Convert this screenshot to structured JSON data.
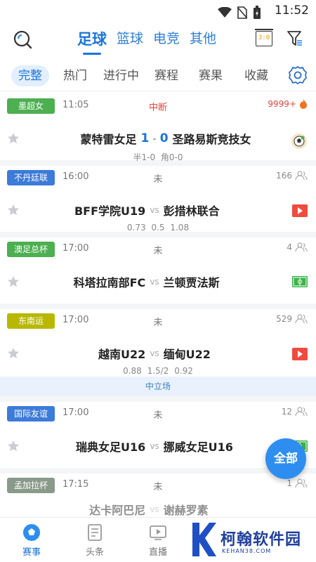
{
  "status_bar": {
    "time": "11:52"
  },
  "header": {
    "sport_tabs": [
      "足球",
      "篮球",
      "电竞",
      "其他"
    ],
    "active_sport": 0,
    "score_icon_text": "3:0"
  },
  "filter_tabs": [
    "完整",
    "热门",
    "进行中",
    "赛程",
    "赛果",
    "收藏"
  ],
  "matches": [
    {
      "league": "墨超女",
      "league_color": "#4caf50",
      "time": "11:05",
      "status": "中断",
      "count": "9999+",
      "home": "蒙特雷女足",
      "away": "圣路易斯竞技女",
      "score_home": "1",
      "score_away": "0",
      "score_sep": "-",
      "odds": "半1-0 角0-0",
      "icon": "live-ball-icon"
    },
    {
      "league": "不丹廷联",
      "league_color": "#3d7bd9",
      "time": "16:00",
      "status": "未",
      "count": "166",
      "home": "BFF学院U19",
      "away": "彭措林联合",
      "vs": "vs",
      "odds": "0.73 0.5 1.08",
      "icon": "video-icon"
    },
    {
      "league": "澳足总杯",
      "league_color": "#4caf50",
      "time": "17:00",
      "status": "未",
      "count": "4",
      "home": "科塔拉南部FC",
      "away": "兰顿贾法斯",
      "vs": "vs",
      "odds": "",
      "icon": "pitch-icon"
    },
    {
      "league": "东南运",
      "league_color": "#b8b800",
      "time": "17:00",
      "status": "未",
      "count": "529",
      "home": "越南U22",
      "away": "缅甸U22",
      "vs": "vs",
      "odds": "0.88 1.5/2 0.92",
      "icon": "video-icon",
      "neutral": "中立场"
    },
    {
      "league": "国际友谊",
      "league_color": "#3d7bd9",
      "time": "17:00",
      "status": "未",
      "count": "12",
      "home": "瑞典女足U16",
      "away": "挪威女足U16",
      "vs": "vs",
      "odds": "",
      "icon": "pitch-icon"
    },
    {
      "league": "孟加拉杯",
      "league_color": "#8a9a8a",
      "time": "17:15",
      "status": "未",
      "count": "1",
      "home": "达卡阿巴尼",
      "away": "谢赫罗素",
      "vs": "vs",
      "odds": "",
      "icon": "pitch-icon"
    }
  ],
  "float_button": "全部",
  "bottom_nav": [
    "赛事",
    "头条",
    "直播"
  ],
  "watermark": {
    "title": "柯翰软件园",
    "sub": "KEHAN38.COM"
  },
  "colors": {
    "accent": "#1a74d8",
    "live": "#e8453c"
  }
}
